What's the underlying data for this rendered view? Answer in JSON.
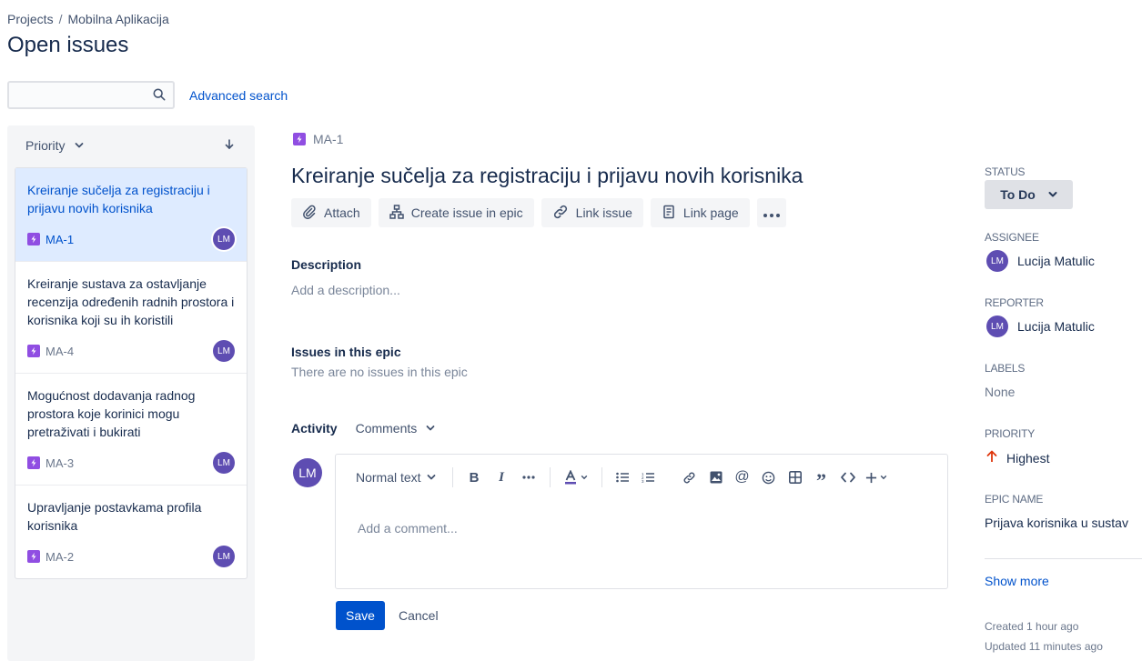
{
  "breadcrumbs": {
    "projects": "Projects",
    "separator": "/",
    "project": "Mobilna Aplikacija"
  },
  "page_title": "Open issues",
  "search": {
    "value": "",
    "placeholder": "",
    "advanced_label": "Advanced search"
  },
  "sort": {
    "label": "Priority"
  },
  "issues": [
    {
      "title": "Kreiranje sučelja za registraciju i prijavu novih korisnika",
      "key": "MA-1",
      "assignee_initials": "LM",
      "selected": true
    },
    {
      "title": "Kreiranje sustava za ostavljanje recenzija određenih radnih prostora i korisnika koji su ih koristili",
      "key": "MA-4",
      "assignee_initials": "LM",
      "selected": false
    },
    {
      "title": "Mogućnost dodavanja radnog prostora koje korinici mogu pretraživati i bukirati",
      "key": "MA-3",
      "assignee_initials": "LM",
      "selected": false
    },
    {
      "title": "Upravljanje postavkama profila korisnika",
      "key": "MA-2",
      "assignee_initials": "LM",
      "selected": false
    }
  ],
  "detail": {
    "key": "MA-1",
    "title": "Kreiranje sučelja za registraciju i prijavu novih korisnika",
    "toolbar": {
      "attach": "Attach",
      "create_in_epic": "Create issue in epic",
      "link_issue": "Link issue",
      "link_page": "Link page"
    },
    "description": {
      "label": "Description",
      "placeholder": "Add a description..."
    },
    "epic_issues": {
      "label": "Issues in this epic",
      "empty": "There are no issues in this epic"
    },
    "activity": {
      "label": "Activity",
      "filter": "Comments"
    },
    "comment": {
      "avatar_initials": "LM",
      "text_style": "Normal text",
      "placeholder": "Add a comment...",
      "save": "Save",
      "cancel": "Cancel"
    }
  },
  "sidebar": {
    "status": {
      "label": "STATUS",
      "value": "To Do"
    },
    "assignee": {
      "label": "ASSIGNEE",
      "initials": "LM",
      "name": "Lucija Matulic"
    },
    "reporter": {
      "label": "REPORTER",
      "initials": "LM",
      "name": "Lucija Matulic"
    },
    "labels": {
      "label": "LABELS",
      "value": "None"
    },
    "priority": {
      "label": "PRIORITY",
      "value": "Highest"
    },
    "epic_name": {
      "label": "EPIC NAME",
      "value": "Prijava korisnika u sustav"
    },
    "show_more": "Show more",
    "created": "Created 1 hour ago",
    "updated": "Updated 11 minutes ago"
  },
  "colors": {
    "link": "#0052cc",
    "epic": "#904ee2",
    "avatar": "#5e4db2",
    "priority_highest": "#de350b",
    "selected_bg": "#deebff"
  }
}
